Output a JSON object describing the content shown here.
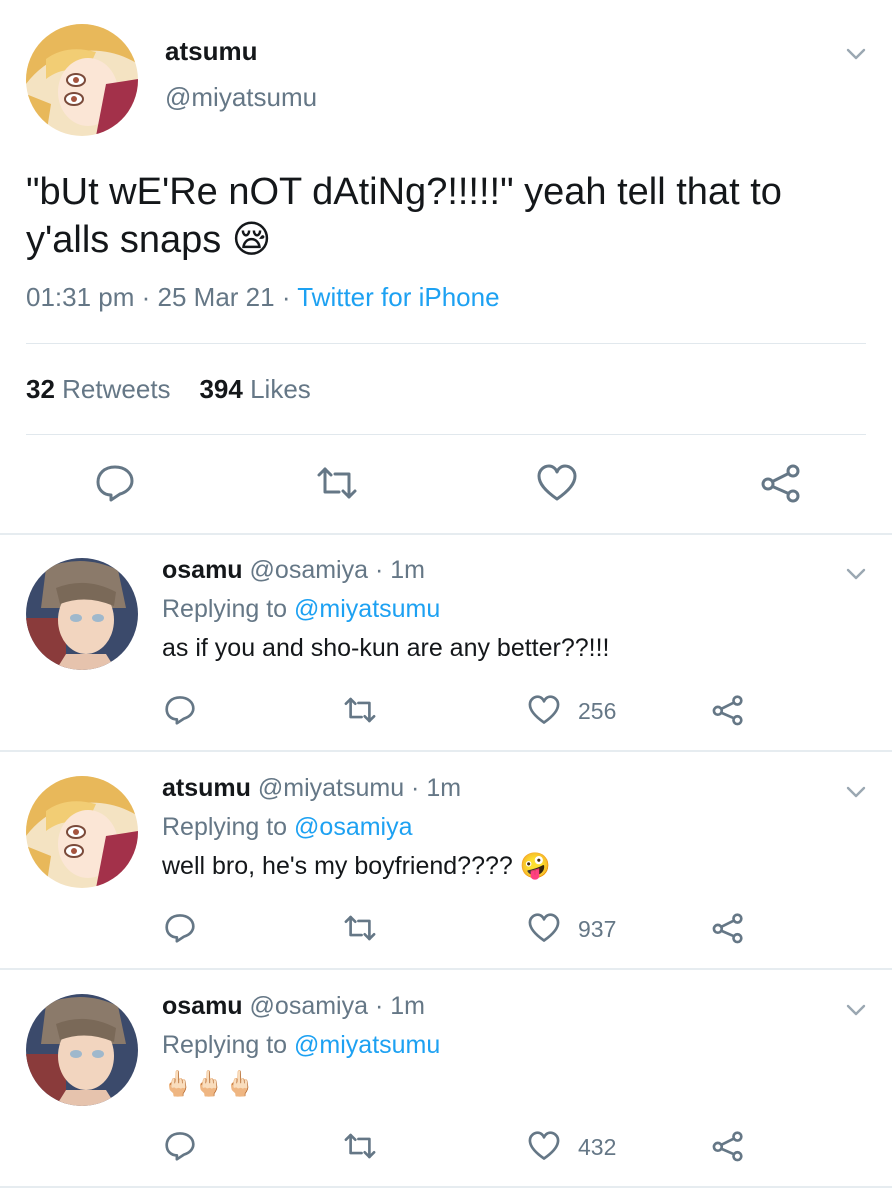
{
  "colors": {
    "link": "#1da1f2",
    "secondary": "#657786",
    "primary_text": "#14171a",
    "divider": "#e1e8ed"
  },
  "main_tweet": {
    "name": "atsumu",
    "handle": "@miyatsumu",
    "text_line1": "\"bUt wE'Re nOT dAtiNg?!!!!!\" yeah tell that to",
    "text_line2": "y'alls snaps",
    "emoji": "😪",
    "time": "01:31 pm",
    "date": "25 Mar 21",
    "source": "Twitter for iPhone",
    "retweets_count": "32",
    "retweets_label": "Retweets",
    "likes_count": "394",
    "likes_label": "Likes",
    "icons": [
      "reply-icon",
      "retweet-icon",
      "like-icon",
      "share-icon"
    ]
  },
  "replies": [
    {
      "name": "osamu",
      "handle": "@osamiya",
      "time": "1m",
      "replying_prefix": "Replying to",
      "replying_to": "@miyatsumu",
      "text": "as if you and sho-kun are any better??!!!",
      "like_count": "256"
    },
    {
      "name": "atsumu",
      "handle": "@miyatsumu",
      "time": "1m",
      "replying_prefix": "Replying to",
      "replying_to": "@osamiya",
      "text": "well bro, he's my boyfriend????",
      "emoji": "🤪",
      "like_count": "937"
    },
    {
      "name": "osamu",
      "handle": "@osamiya",
      "time": "1m",
      "replying_prefix": "Replying to",
      "replying_to": "@miyatsumu",
      "text": "🖕🏻🖕🏻🖕🏻",
      "like_count": "432"
    }
  ]
}
